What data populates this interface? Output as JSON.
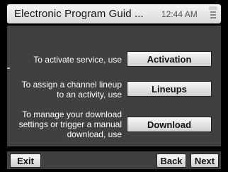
{
  "header": {
    "title": "Electronic Program Guid ...",
    "time": "12:44 AM",
    "menu_icon": "menu-icon"
  },
  "rows": [
    {
      "label": "To activate service, use",
      "button": "Activation"
    },
    {
      "label_lines": [
        "To assign a channel lineup",
        "to an activity, use"
      ],
      "button": "Lineups"
    },
    {
      "label_lines": [
        "To manage your download",
        "settings or trigger a manual",
        "download, use"
      ],
      "button": "Download"
    }
  ],
  "footer": {
    "exit": "Exit",
    "back": "Back",
    "next": "Next"
  }
}
